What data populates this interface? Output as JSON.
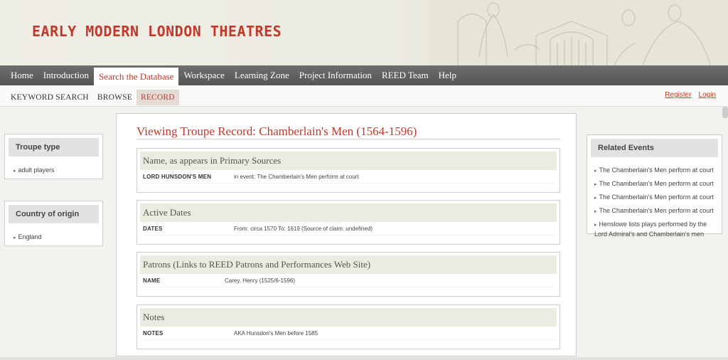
{
  "site": {
    "title": "EARLY MODERN LONDON THEATRES"
  },
  "mainnav": [
    "Home",
    "Introduction",
    "Search the Database",
    "Workspace",
    "Learning Zone",
    "Project Information",
    "REED Team",
    "Help"
  ],
  "subnav": [
    "KEYWORD SEARCH",
    "BROWSE",
    "RECORD"
  ],
  "auth": {
    "register": "Register",
    "login": "Login"
  },
  "left_panels": {
    "troupe_type": {
      "title": "Troupe type",
      "items": [
        "adult players"
      ]
    },
    "country": {
      "title": "Country of origin",
      "items": [
        "England"
      ]
    }
  },
  "main": {
    "title": "Viewing Troupe Record: Chamberlain's Men (1564-1596)",
    "sections": [
      {
        "title": "Name, as appears in Primary Sources",
        "key": "LORD HUNSDON'S MEN",
        "value": "in event: The Chamberlain's Men perform at court"
      },
      {
        "title": "Active Dates",
        "key": "DATES",
        "value": "From: circa 1570 To: 1619 (Source of claim: undefined)"
      },
      {
        "title": "Patrons (Links to REED Patrons and Performances Web Site)",
        "key": "NAME",
        "value": "Carey, Henry (1525/6-1596)"
      },
      {
        "title": "Notes",
        "key": "NOTES",
        "value": "AKA Hunsdon's Men before 1585"
      }
    ]
  },
  "related": {
    "title": "Related Events",
    "items": [
      "The Chamberlain's Men perform at court",
      "The Chamberlain's Men perform at court",
      "The Chamberlain's Men perform at court",
      "The Chamberlain's Men perform at court",
      "Henslowe lists plays performed by the Lord Admiral's and Chamberlain's men"
    ]
  },
  "colors": {
    "accent": "#c0392b",
    "nav_bg": "#5e5e5e"
  }
}
